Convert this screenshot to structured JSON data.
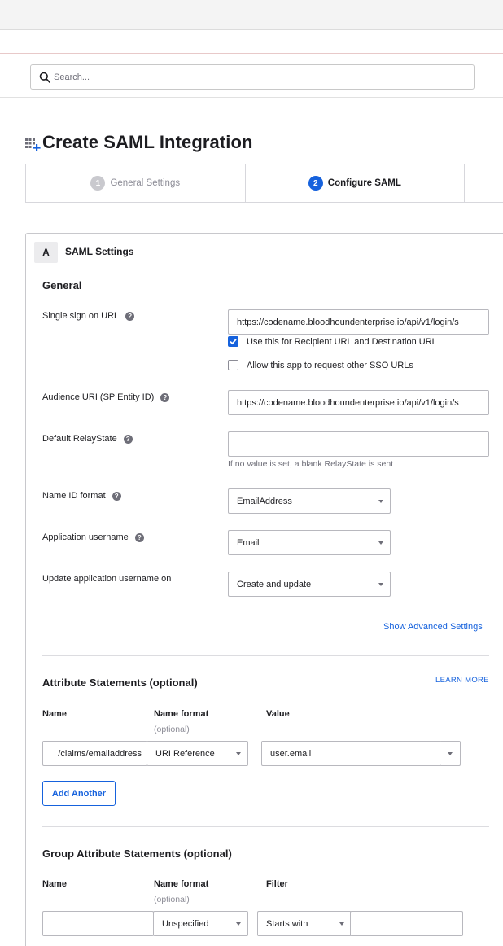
{
  "search": {
    "placeholder": "Search..."
  },
  "page": {
    "title": "Create SAML Integration"
  },
  "steps": [
    {
      "num": "1",
      "label": "General Settings"
    },
    {
      "num": "2",
      "label": "Configure SAML"
    }
  ],
  "section": {
    "tag": "A",
    "title": "SAML Settings"
  },
  "general": {
    "heading": "General",
    "sso_url": {
      "label": "Single sign on URL",
      "value": "https://codename.bloodhoundenterprise.io/api/v1/login/s"
    },
    "recipient_checkbox": {
      "label": "Use this for Recipient URL and Destination URL",
      "checked": true
    },
    "allow_sso_checkbox": {
      "label": "Allow this app to request other SSO URLs",
      "checked": false
    },
    "audience_uri": {
      "label": "Audience URI (SP Entity ID)",
      "value": "https://codename.bloodhoundenterprise.io/api/v1/login/s"
    },
    "relay_state": {
      "label": "Default RelayState",
      "value": "",
      "hint": "If no value is set, a blank RelayState is sent"
    },
    "name_id_format": {
      "label": "Name ID format",
      "value": "EmailAddress"
    },
    "app_username": {
      "label": "Application username",
      "value": "Email"
    },
    "update_username": {
      "label": "Update application username on",
      "value": "Create and update"
    },
    "advanced_link": "Show Advanced Settings"
  },
  "attributes": {
    "heading": "Attribute Statements (optional)",
    "learn_more": "LEARN MORE",
    "col_name": "Name",
    "col_format": "Name format",
    "col_format_sub": "(optional)",
    "col_value": "Value",
    "row": {
      "name": "/claims/emailaddress",
      "format": "URI Reference",
      "value": "user.email"
    },
    "add_button": "Add Another"
  },
  "group_attributes": {
    "heading": "Group Attribute Statements (optional)",
    "col_name": "Name",
    "col_format": "Name format",
    "col_format_sub": "(optional)",
    "col_filter": "Filter",
    "row": {
      "name": "",
      "format": "Unspecified",
      "filter": "Starts with",
      "filter_value": ""
    }
  },
  "colors": {
    "accent": "#1662dd",
    "border": "#b8b8be",
    "muted": "#6e6e78"
  }
}
